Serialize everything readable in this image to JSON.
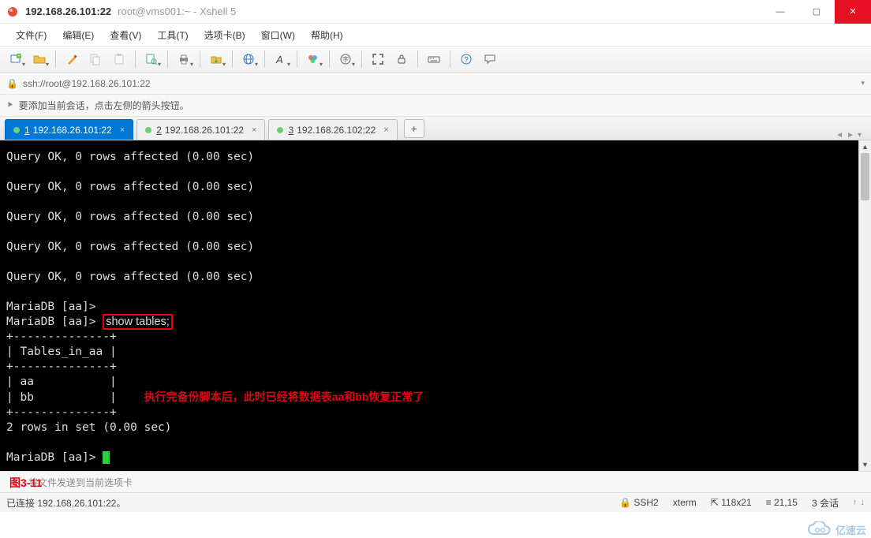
{
  "window": {
    "host": "192.168.26.101:22",
    "title_suffix": "root@vms001:~ - Xshell 5"
  },
  "menu": [
    "文件(F)",
    "编辑(E)",
    "查看(V)",
    "工具(T)",
    "选项卡(B)",
    "窗口(W)",
    "帮助(H)"
  ],
  "toolbar_icons": [
    "new-session-icon",
    "open-icon",
    "sep",
    "props-icon",
    "copy-icon",
    "paste-icon",
    "sep",
    "find-icon",
    "sep",
    "print-icon",
    "sep",
    "transfer-icon",
    "sep",
    "globe-icon",
    "sep",
    "font-icon",
    "sep",
    "color-icon",
    "sep",
    "encoding-icon",
    "sep",
    "fullscreen-icon",
    "lock-icon",
    "sep",
    "keyboard-icon",
    "sep",
    "help-icon",
    "speech-icon"
  ],
  "address": {
    "scheme_text": "ssh://root@192.168.26.101:22"
  },
  "infobar": {
    "text": "要添加当前会话，点击左侧的箭头按钮。"
  },
  "tabs": [
    {
      "num": "1",
      "label": "192.168.26.101:22",
      "active": true
    },
    {
      "num": "2",
      "label": "192.168.26.101:22",
      "active": false
    },
    {
      "num": "3",
      "label": "192.168.26.102:22",
      "active": false
    }
  ],
  "terminal": {
    "lines_before": [
      "Query OK, 0 rows affected (0.00 sec)",
      "",
      "Query OK, 0 rows affected (0.00 sec)",
      "",
      "Query OK, 0 rows affected (0.00 sec)",
      "",
      "Query OK, 0 rows affected (0.00 sec)",
      "",
      "Query OK, 0 rows affected (0.00 sec)",
      "",
      "MariaDB [aa]>"
    ],
    "prompt_line_prefix": "MariaDB [aa]> ",
    "highlighted_cmd": "show tables;",
    "table_top": "+--------------+",
    "table_header": "| Tables_in_aa |",
    "table_sep": "+--------------+",
    "table_row1": "| aa           |",
    "table_row2": "| bb           |",
    "annotation": "执行完备份脚本后，此时已经将数据表aa和bb恢复正常了",
    "table_bottom": "+--------------+",
    "rows_line": "2 rows in set (0.00 sec)",
    "prompt_final": "MariaDB [aa]> "
  },
  "figure_label": "图3-11",
  "inputbar_placeholder": "将文件发送到当前选项卡",
  "status": {
    "conn": "已连接 192.168.26.101:22。",
    "proto": "SSH2",
    "term": "xterm",
    "size": "118x21",
    "pos": "21,15",
    "sessions": "3 会话"
  },
  "watermark": "亿速云"
}
